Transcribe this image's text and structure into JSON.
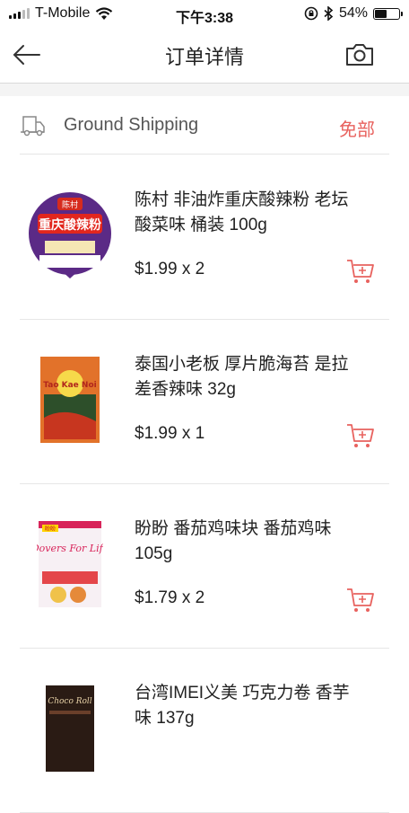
{
  "status_bar": {
    "carrier": "T-Mobile",
    "time": "下午3:38",
    "battery_percent": "54%",
    "battery_level": 0.54,
    "icons": [
      "signal-icon",
      "wifi-icon",
      "orientation-lock-icon",
      "bluetooth-icon",
      "battery-icon"
    ]
  },
  "nav": {
    "title": "订单详情",
    "back_icon": "back-arrow-icon",
    "camera_icon": "camera-icon"
  },
  "shipping": {
    "icon": "truck-icon",
    "label": "Ground Shipping",
    "fee": "免部",
    "accent_color": "#e8625e"
  },
  "products": [
    {
      "name": "陈村 非油炸重庆酸辣粉 老坛酸菜味 桶装 100g",
      "price": "$1.99 x 2",
      "thumb_text": "重庆酸辣粉",
      "thumb_badge": "陈村"
    },
    {
      "name": "泰国小老板 厚片脆海苔 是拉差香辣味 32g",
      "price": "$1.99 x 1",
      "thumb_text": "Tao Kae Noi"
    },
    {
      "name": "盼盼 番茄鸡味块 番茄鸡味 105g",
      "price": "$1.79 x 2",
      "thumb_text": "Dovers For Life",
      "thumb_badge": "盼盼"
    },
    {
      "name": "台湾IMEI义美 巧克力卷 香芋味 137g",
      "price": "",
      "thumb_text": "Choco Roll"
    }
  ]
}
